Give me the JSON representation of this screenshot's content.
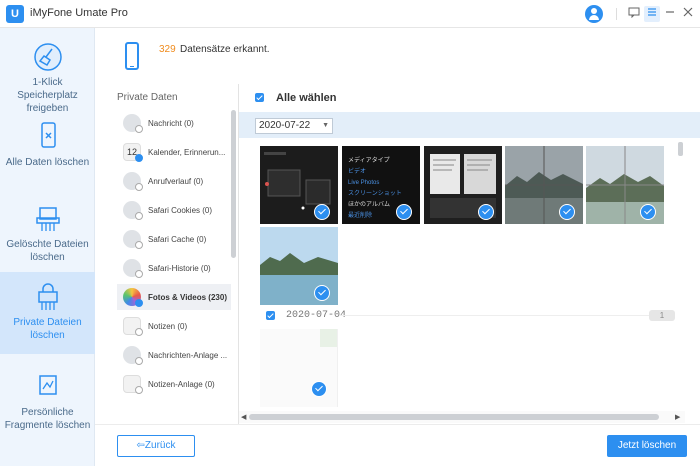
{
  "app": {
    "title": "iMyFone Umate Pro",
    "logo_text": "U"
  },
  "titlebar": {
    "icons": [
      "user-avatar-icon",
      "feedback-icon",
      "menu-icon",
      "minimize-icon",
      "close-icon"
    ]
  },
  "sidebar": {
    "items": [
      {
        "label": "1-Klick Speicherplatz freigeben",
        "icon": "broom-icon",
        "active": false
      },
      {
        "label": "Alle Daten löschen",
        "icon": "phone-erase-icon",
        "active": false
      },
      {
        "label": "Gelöschte Dateien löschen",
        "icon": "shredder-icon",
        "active": false
      },
      {
        "label": "Private Dateien löschen",
        "icon": "lock-shredder-icon",
        "active": true
      },
      {
        "label": "Persönliche Fragmente löschen",
        "icon": "fragment-icon",
        "active": false
      }
    ]
  },
  "header": {
    "count": "329",
    "count_text": "Datensätze erkannt."
  },
  "categories": {
    "title": "Private Daten",
    "items": [
      {
        "label": "Nachricht (0)",
        "icon": "message-icon",
        "checked": false,
        "selected": false
      },
      {
        "label": "Kalender, Erinnerun...",
        "icon": "calendar-icon",
        "checked": true,
        "selected": false
      },
      {
        "label": "Anrufverlauf (0)",
        "icon": "phone-call-icon",
        "checked": false,
        "selected": false
      },
      {
        "label": "Safari Cookies (0)",
        "icon": "safari-icon",
        "checked": false,
        "selected": false
      },
      {
        "label": "Safari Cache (0)",
        "icon": "safari-icon",
        "checked": false,
        "selected": false
      },
      {
        "label": "Safari-Historie (0)",
        "icon": "safari-icon",
        "checked": false,
        "selected": false
      },
      {
        "label": "Fotos & Videos (230)",
        "icon": "photos-icon",
        "checked": true,
        "selected": true
      },
      {
        "label": "Notizen (0)",
        "icon": "notes-icon",
        "checked": false,
        "selected": false
      },
      {
        "label": "Nachrichten-Anlage ...",
        "icon": "message-attachment-icon",
        "checked": false,
        "selected": false
      },
      {
        "label": "Notizen-Anlage (0)",
        "icon": "notes-attachment-icon",
        "checked": false,
        "selected": false
      }
    ]
  },
  "main": {
    "select_all_label": "Alle wählen",
    "date_filter": "2020-07-22",
    "group_date": "2020-07-04",
    "group_badge": "1",
    "japanese_thumb_lines": [
      "メディアタイプ",
      "ビデオ",
      "Live Photos",
      "スクリーンショット",
      "ほかのアルバム",
      "最近削除"
    ]
  },
  "footer": {
    "back_label": "Zurück",
    "delete_label": "Jetzt löschen"
  }
}
